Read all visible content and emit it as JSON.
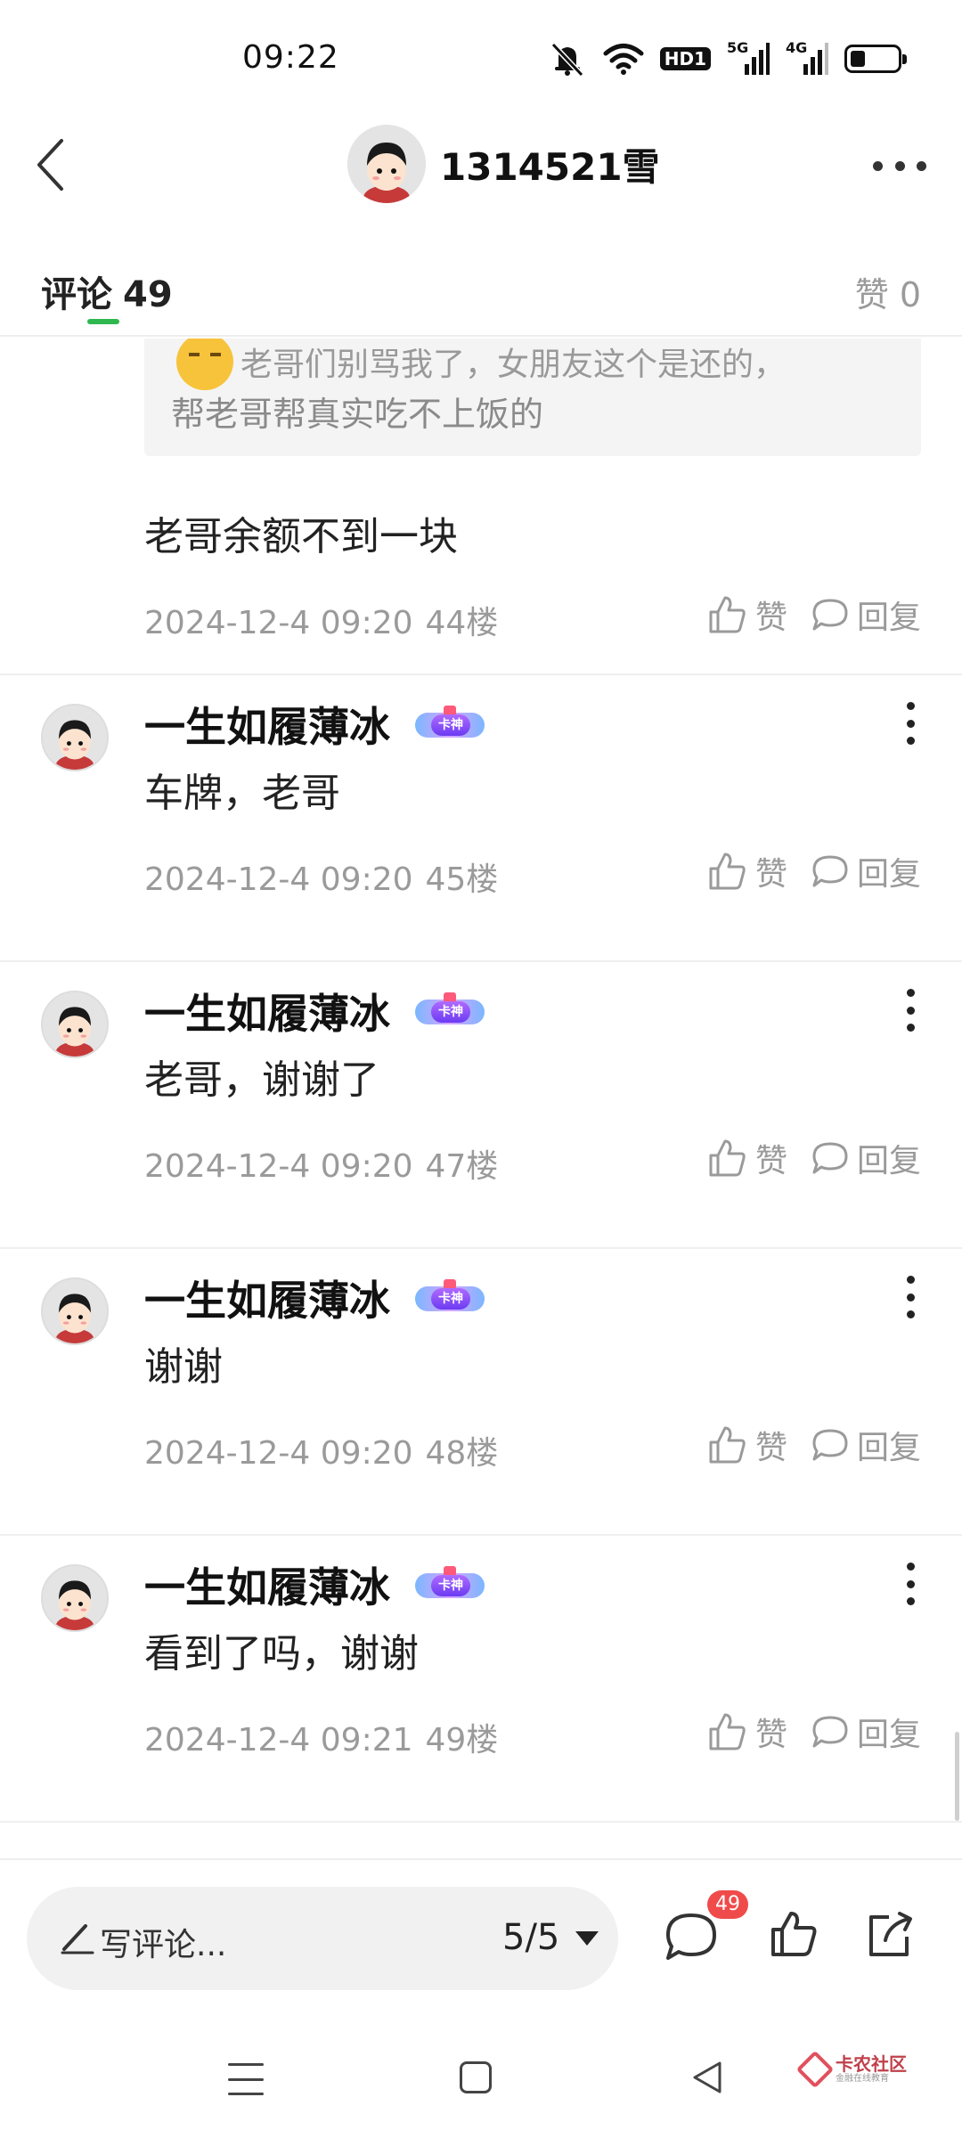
{
  "status": {
    "time": "09:22",
    "hd_label": "HD1",
    "net1": "5G",
    "net2": "4G"
  },
  "header": {
    "username": "1314521雪"
  },
  "tabs": {
    "comments_label": "评论",
    "comments_count": "49",
    "likes_label": "赞 0"
  },
  "quoted": {
    "line1": "老哥们别骂我了，女朋友这个是还的，",
    "line2": "帮老哥帮真实吃不上饭的"
  },
  "comments": [
    {
      "text": "老哥余额不到一块",
      "time": "2024-12-4 09:20",
      "floor": "44楼"
    },
    {
      "username": "一生如履薄冰",
      "badge": "卡神",
      "text": "车牌，老哥",
      "time": "2024-12-4 09:20",
      "floor": "45楼"
    },
    {
      "username": "一生如履薄冰",
      "badge": "卡神",
      "text": "老哥，谢谢了",
      "time": "2024-12-4 09:20",
      "floor": "47楼"
    },
    {
      "username": "一生如履薄冰",
      "badge": "卡神",
      "text": "谢谢",
      "time": "2024-12-4 09:20",
      "floor": "48楼"
    },
    {
      "username": "一生如履薄冰",
      "badge": "卡神",
      "text": "看到了吗，谢谢",
      "time": "2024-12-4 09:21",
      "floor": "49楼"
    }
  ],
  "actions": {
    "like_label": "赞",
    "reply_label": "回复"
  },
  "bottom": {
    "input_placeholder": "写评论...",
    "page": "5/5",
    "comment_count": "49"
  },
  "watermark": {
    "title": "卡农社区",
    "subtitle": "金融在线教育"
  },
  "colors": {
    "accent_green": "#2fb84f",
    "badge_red": "#f04b4b",
    "muted_text": "#9a9a9a"
  }
}
